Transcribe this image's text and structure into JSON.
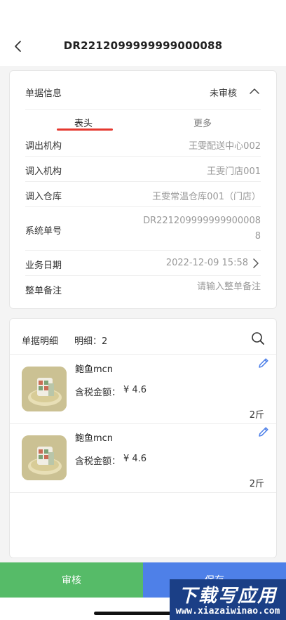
{
  "nav": {
    "title": "DR221209999999900008 8",
    "title_display": "DR2212099999999000088",
    "back_icon": "chevron-left-icon"
  },
  "info": {
    "section_label": "单据信息",
    "status": "未审核",
    "collapse_icon": "chevron-up-icon",
    "tabs": [
      {
        "label": "表头",
        "active": true
      },
      {
        "label": "更多",
        "active": false
      }
    ],
    "active_tab_color": "#e5382f",
    "rows": [
      {
        "key": "调出机构",
        "value": "王雯配送中心002"
      },
      {
        "key": "调入机构",
        "value": "王雯门店001"
      },
      {
        "key": "调入仓库",
        "value": "王雯常温仓库001（门店）"
      },
      {
        "key": "系统单号",
        "value": "DR2212099999999000088"
      },
      {
        "key": "业务日期",
        "value": "2022-12-09 15:58"
      },
      {
        "key": "整单备注",
        "placeholder": "请输入整单备注",
        "value": ""
      }
    ]
  },
  "detail": {
    "section_label": "单据明细",
    "count_label": "明细：2",
    "search_icon": "search-icon",
    "items": [
      {
        "name": "鲍鱼mcn",
        "price_label": "含税金额：",
        "price": "¥ 4.6",
        "qty": "2斤",
        "edit_icon": "pencil-icon"
      },
      {
        "name": "鲍鱼mcn",
        "price_label": "含税金额：",
        "price": "¥ 4.6",
        "qty": "2斤",
        "edit_icon": "pencil-icon"
      }
    ]
  },
  "actions": {
    "audit_label": "审核",
    "save_label": "保存",
    "audit_color": "#56bb68",
    "save_color": "#4e80e8"
  },
  "watermark": {
    "main": "下载写应用",
    "sub": "www.xiazaiwinao.com"
  }
}
